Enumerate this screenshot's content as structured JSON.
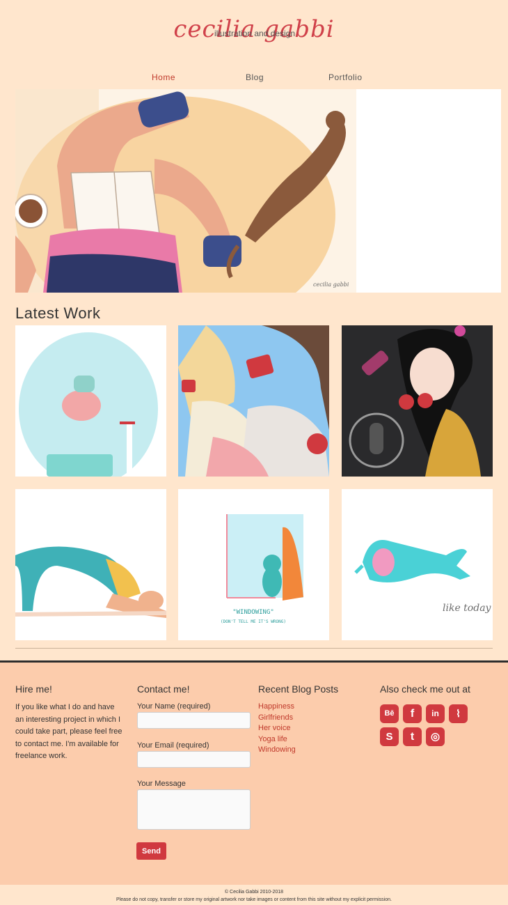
{
  "header": {
    "title": "cecilia gabbi",
    "subtitle": "illustration and design"
  },
  "nav": {
    "items": [
      {
        "label": "Home",
        "active": true
      },
      {
        "label": "Blog",
        "active": false
      },
      {
        "label": "Portfolio",
        "active": false
      }
    ]
  },
  "hero": {
    "signature": "cecilia gabbi"
  },
  "latest_work": {
    "title": "Latest Work",
    "tiles": [
      {
        "alt": "bubble character illustration"
      },
      {
        "alt": "girlfriends illustration"
      },
      {
        "alt": "her voice illustration"
      },
      {
        "alt": "yoga life illustration"
      },
      {
        "alt": "windowing illustration",
        "caption": "\"WINDOWING\"",
        "subcaption": "(DON'T TELL ME IT'S WRONG)"
      },
      {
        "alt": "like today illustration",
        "caption": "like today"
      }
    ]
  },
  "footer": {
    "hire": {
      "title": "Hire me!",
      "text": "If you like what I do and have an interesting project in which I could take part, please feel free to contact me. I'm available for freelance work."
    },
    "contact": {
      "title": "Contact me!",
      "name_label": "Your Name (required)",
      "email_label": "Your Email (required)",
      "message_label": "Your Message",
      "send_label": "Send"
    },
    "blog": {
      "title": "Recent Blog Posts",
      "posts": [
        "Happiness",
        "Girlfriends",
        "Her voice",
        "Yoga life",
        "Windowing"
      ]
    },
    "social": {
      "title": "Also check me out at",
      "icons": [
        {
          "name": "behance-icon",
          "glyph": "Bē"
        },
        {
          "name": "facebook-icon",
          "glyph": "f"
        },
        {
          "name": "linkedin-icon",
          "glyph": "in"
        },
        {
          "name": "rss-icon",
          "glyph": "⌇"
        },
        {
          "name": "skype-icon",
          "glyph": "S"
        },
        {
          "name": "tumblr-icon",
          "glyph": "t"
        },
        {
          "name": "instagram-icon",
          "glyph": "◎"
        }
      ]
    }
  },
  "bottom": {
    "copyright": "© Cecilia Gabbi 2010-2018",
    "notice": "Please do not copy, transfer or store my original artwork nor take images or content from this site without my explicit permission."
  },
  "colors": {
    "accent": "#d0393f",
    "background": "#ffe6cd",
    "footer_bg": "#fcccac"
  }
}
